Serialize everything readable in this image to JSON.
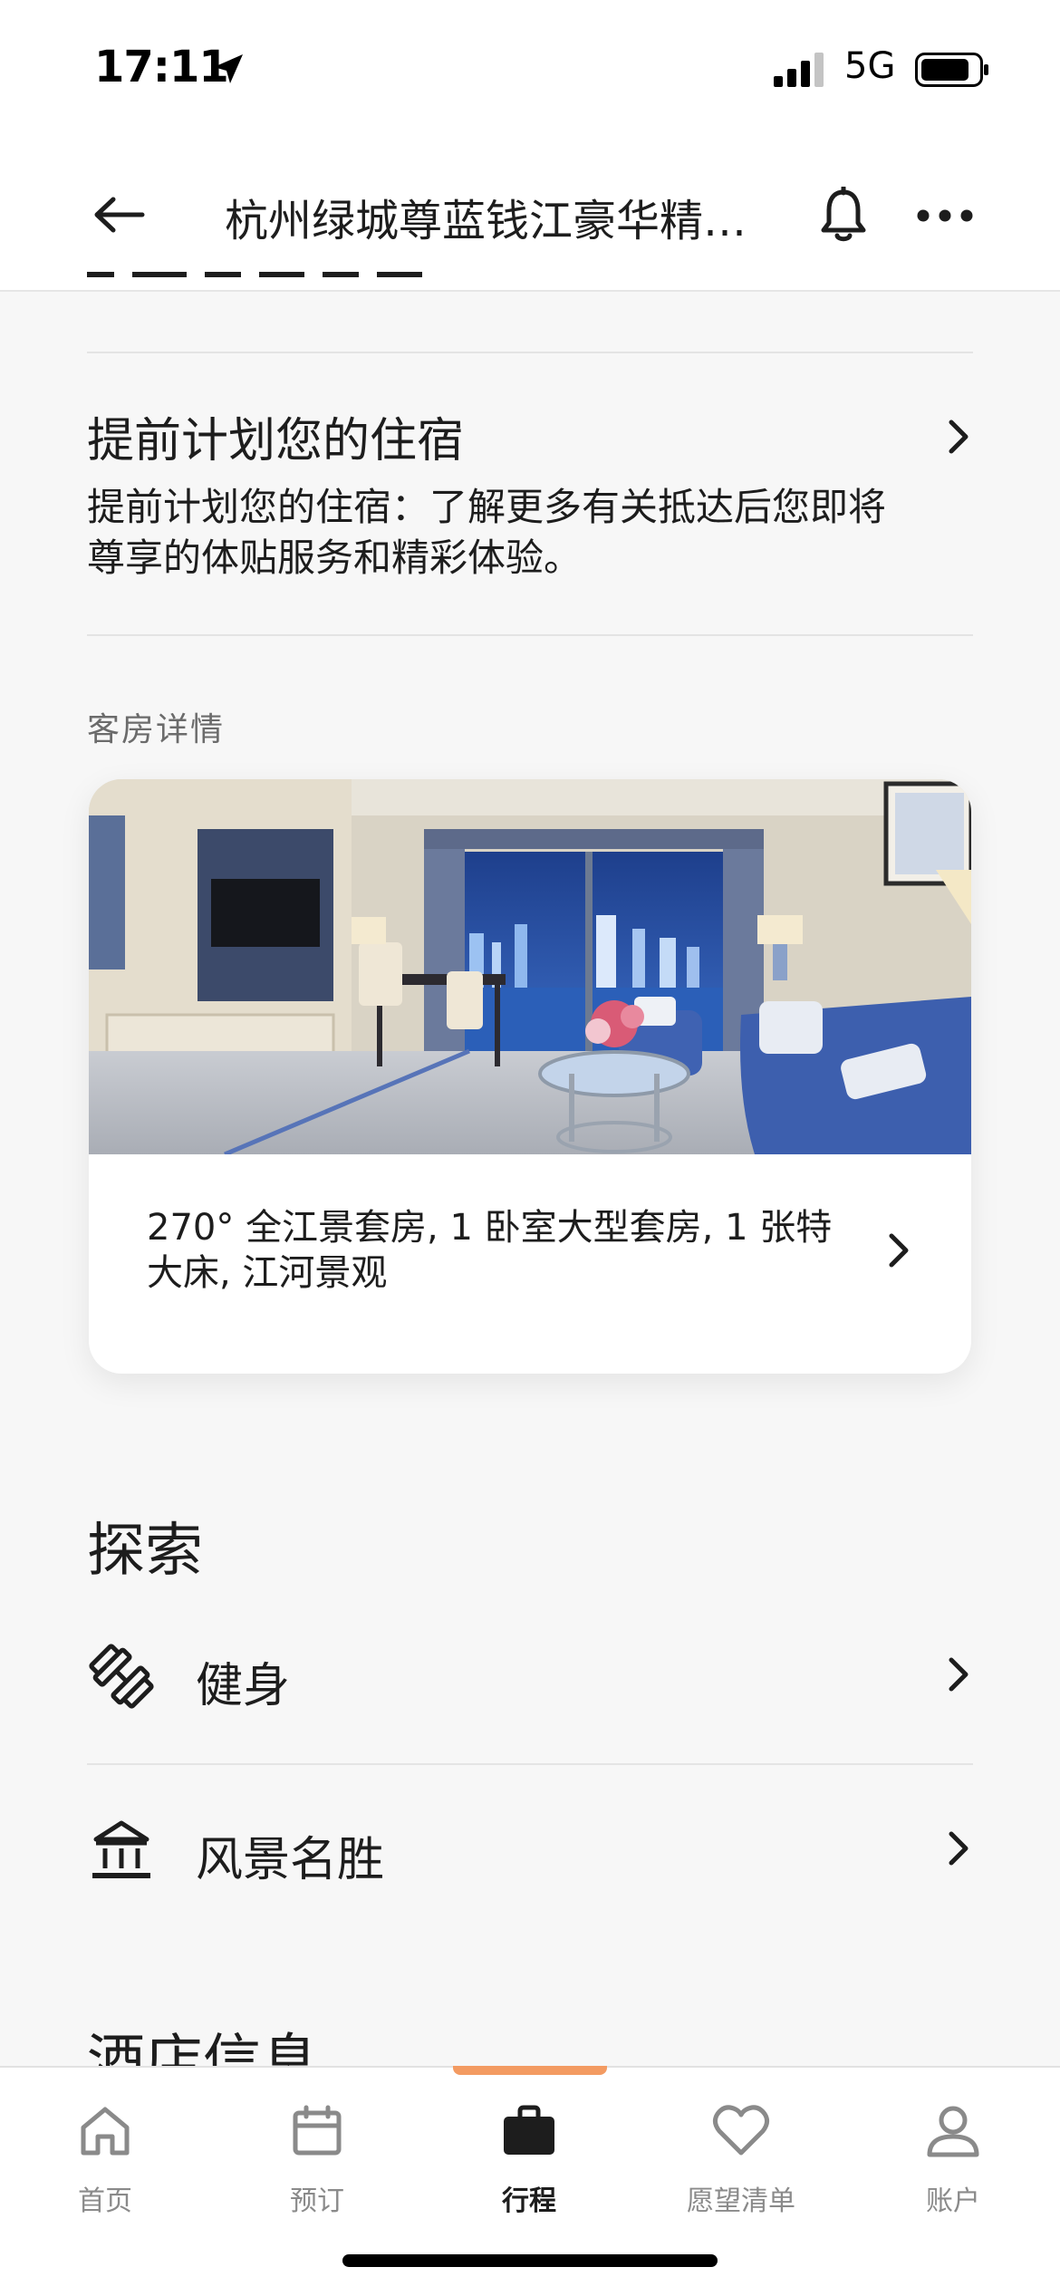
{
  "status_bar": {
    "time": "17:11",
    "network": "5G"
  },
  "header": {
    "title": "杭州绿城尊蓝钱江豪华精…"
  },
  "plan_stay": {
    "title": "提前计划您的住宿",
    "description": "提前计划您的住宿：了解更多有关抵达后您即将尊享的体贴服务和精彩体验。"
  },
  "room_section": {
    "label": "客房详情",
    "room_name": "270° 全江景套房, 1 卧室大型套房, 1 张特大床, 江河景观"
  },
  "explore": {
    "title": "探索",
    "items": [
      {
        "label": "健身",
        "icon": "dumbbell-icon"
      },
      {
        "label": "风景名胜",
        "icon": "landmark-icon"
      }
    ]
  },
  "hotel_info": {
    "title": "酒店信息"
  },
  "tabs": [
    {
      "label": "首页",
      "icon": "home-icon"
    },
    {
      "label": "预订",
      "icon": "calendar-icon"
    },
    {
      "label": "行程",
      "icon": "briefcase-icon",
      "active": true
    },
    {
      "label": "愿望清单",
      "icon": "heart-icon"
    },
    {
      "label": "账户",
      "icon": "user-icon"
    }
  ],
  "colors": {
    "accent": "#f39b62",
    "text": "#1d1d1d",
    "muted": "#8a8a8a",
    "background": "#f7f7f7"
  }
}
